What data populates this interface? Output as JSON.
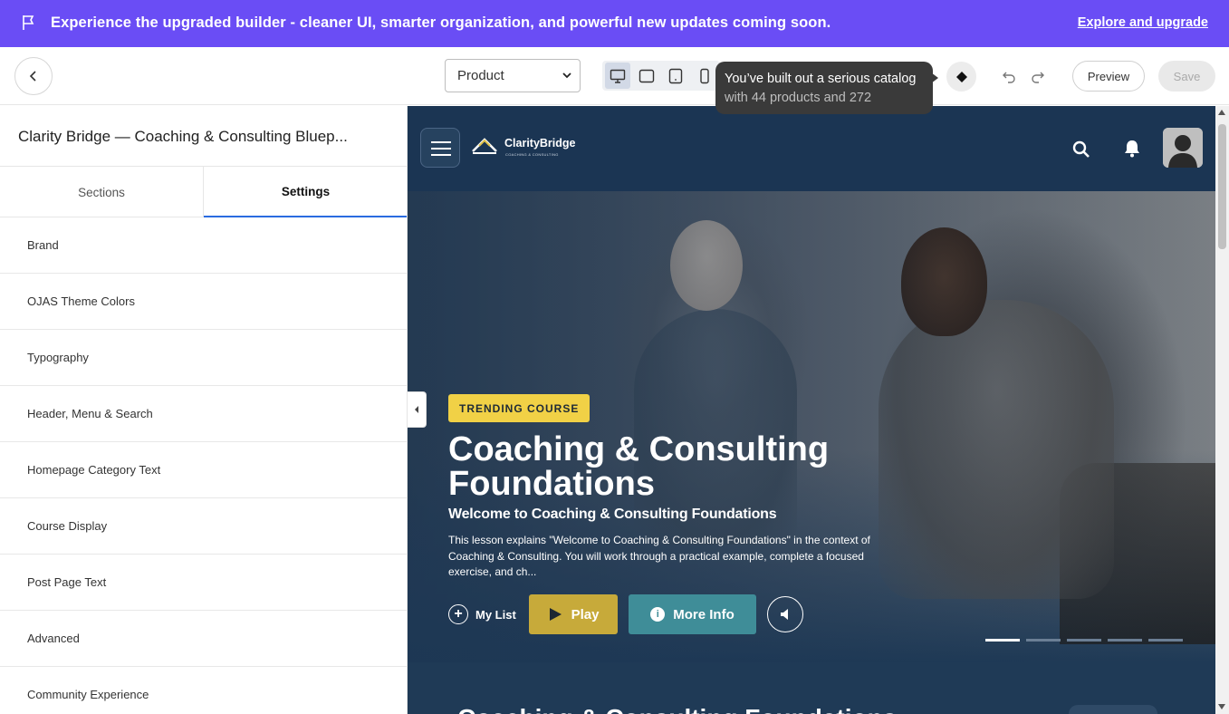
{
  "banner": {
    "icon": "flag-icon",
    "message": "Experience the upgraded builder - cleaner UI, smarter organization, and powerful new updates coming soon.",
    "link": "Explore and upgrade",
    "color": "#6a4df5"
  },
  "toolbar": {
    "page_select": "Product",
    "devices": [
      "desktop-icon",
      "tablet-landscape-icon",
      "tablet-portrait-icon",
      "mobile-icon"
    ],
    "active_device": "desktop",
    "tooltip_line1": "You’ve built out a serious catalog",
    "tooltip_line2": "with 44 products and 272",
    "preview_label": "Preview",
    "save_label": "Save"
  },
  "panel": {
    "title": "Clarity Bridge — Coaching & Consulting Bluep...",
    "tabs": [
      {
        "label": "Sections"
      },
      {
        "label": "Settings"
      }
    ],
    "active_tab": "Settings",
    "items": [
      {
        "label": "Brand"
      },
      {
        "label": "OJAS Theme Colors"
      },
      {
        "label": "Typography"
      },
      {
        "label": "Header, Menu & Search"
      },
      {
        "label": "Homepage Category Text"
      },
      {
        "label": "Course Display"
      },
      {
        "label": "Post Page Text"
      },
      {
        "label": "Advanced"
      },
      {
        "label": "Community Experience"
      }
    ]
  },
  "site": {
    "logo_name": "ClarityBridge",
    "logo_sub": "COACHING & CONSULTING",
    "hero": {
      "badge": "TRENDING COURSE",
      "title": "Coaching & Consulting Foundations",
      "subtitle": "Welcome to Coaching & Consulting Foundations",
      "description": "This lesson explains \"Welcome to Coaching & Consulting Foundations\" in the context of Coaching & Consulting. You will work through a practical example, complete a focused exercise, and ch...",
      "mylist_label": "My List",
      "play_label": "Play",
      "info_label": "More Info",
      "slides": 5,
      "active_slide": 1
    },
    "section_title": "Coaching & Consulting Foundations"
  }
}
